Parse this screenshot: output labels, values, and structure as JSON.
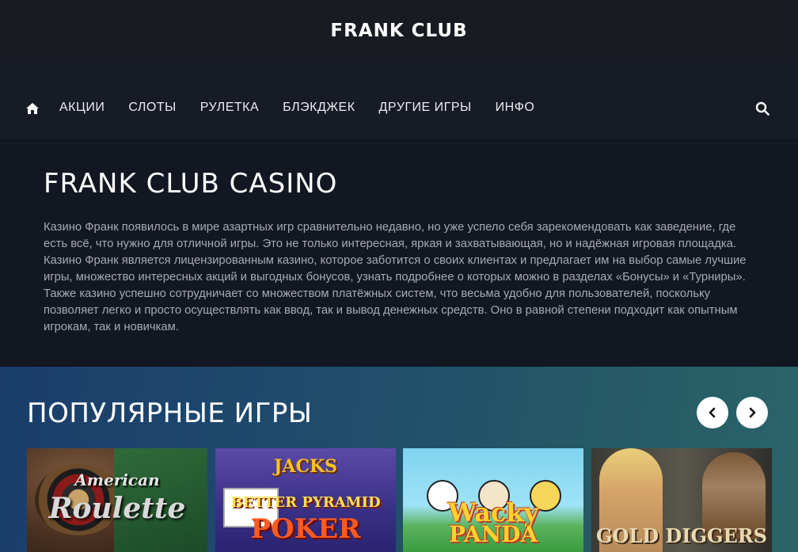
{
  "header": {
    "logo": "FRANK CLUB"
  },
  "nav": {
    "home_icon": "home-icon",
    "items": [
      {
        "label": "АКЦИИ"
      },
      {
        "label": "СЛОТЫ"
      },
      {
        "label": "РУЛЕТКА"
      },
      {
        "label": "БЛЭКДЖЕК"
      },
      {
        "label": "ДРУГИЕ ИГРЫ"
      },
      {
        "label": "ИНФО"
      }
    ],
    "search_icon": "search-icon"
  },
  "intro": {
    "title": "FRANK CLUB CASINO",
    "text": "Казино Франк появилось в мире азартных игр сравнительно недавно, но уже успело себя зарекомендовать как заведение, где есть всё, что нужно для отличной игры. Это не только интересная, яркая и захватывающая, но и надёжная игровая площадка. Казино Франк является лицензированным казино, которое заботится о своих клиентах и предлагает им на выбор самые лучшие игры, множество интересных акций и выгодных бонусов, узнать подробнее о которых можно в разделах «Бонусы» и «Турниры». Также казино успешно сотрудничает со множеством платёжных систем, что весьма удобно для пользователей, поскольку позволяет легко и просто осуществлять как ввод, так и вывод денежных средств. Оно в равной степени подходит как опытным игрокам, так и новичкам."
  },
  "popular": {
    "title": "ПОПУЛЯРНЫЕ ИГРЫ",
    "prev_icon": "chevron-left-icon",
    "next_icon": "chevron-right-icon",
    "games": [
      {
        "line1": "American",
        "line2": "Roulette"
      },
      {
        "line1": "JACKS",
        "line2": "BETTER PYRAMID",
        "line3": "POKER"
      },
      {
        "line1": "Wacky",
        "line2": "PANDA"
      },
      {
        "line1": "GOLD DIGGERS"
      }
    ]
  },
  "colors": {
    "background": "#121722",
    "topbar": "#191b22",
    "navbar": "#171b26",
    "text_muted": "#a7aab5",
    "popular_gradient_start": "#1a3d6a",
    "popular_gradient_end": "#2a6468"
  }
}
